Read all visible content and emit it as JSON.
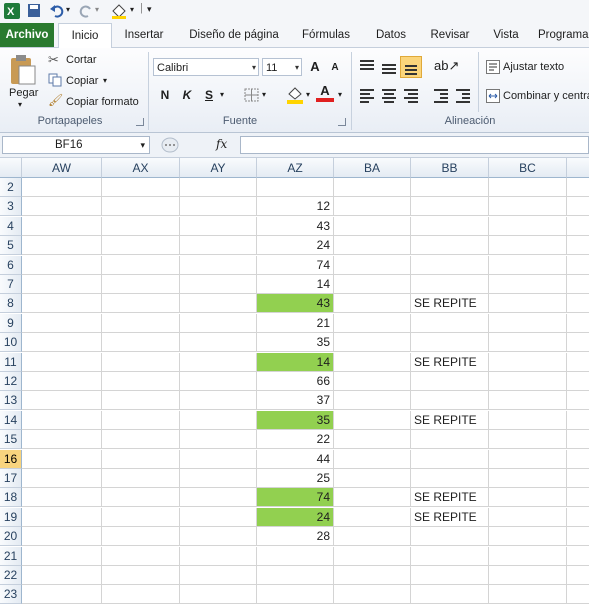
{
  "qat": {
    "icons": [
      "excel-logo-icon",
      "save-icon",
      "undo-icon",
      "redo-icon",
      "fill-color-icon",
      "customize-icon"
    ]
  },
  "tabs": [
    "Archivo",
    "Inicio",
    "Insertar",
    "Diseño de página",
    "Fórmulas",
    "Datos",
    "Revisar",
    "Vista",
    "Programa"
  ],
  "ribbon": {
    "clipboard": {
      "paste": "Pegar",
      "cut": "Cortar",
      "copy": "Copiar",
      "format_painter": "Copiar formato",
      "group": "Portapapeles"
    },
    "font": {
      "name": "Calibri",
      "size": "11",
      "bold": "N",
      "italic": "K",
      "underline": "S",
      "grow": "A",
      "shrink": "A",
      "group": "Fuente"
    },
    "alignment": {
      "wrap": "Ajustar texto",
      "merge": "Combinar y centrar",
      "group": "Alineación"
    }
  },
  "formula_bar": {
    "namebox": "BF16",
    "fx": "fx",
    "value": ""
  },
  "columns": [
    "AW",
    "AX",
    "AY",
    "AZ",
    "BA",
    "BB",
    "BC"
  ],
  "active_row": 16,
  "rows": [
    {
      "n": "2",
      "az": "",
      "bb": "",
      "green": false
    },
    {
      "n": "3",
      "az": "12",
      "bb": "",
      "green": false
    },
    {
      "n": "4",
      "az": "43",
      "bb": "",
      "green": false
    },
    {
      "n": "5",
      "az": "24",
      "bb": "",
      "green": false
    },
    {
      "n": "6",
      "az": "74",
      "bb": "",
      "green": false
    },
    {
      "n": "7",
      "az": "14",
      "bb": "",
      "green": false
    },
    {
      "n": "8",
      "az": "43",
      "bb": "SE REPITE",
      "green": true
    },
    {
      "n": "9",
      "az": "21",
      "bb": "",
      "green": false
    },
    {
      "n": "10",
      "az": "35",
      "bb": "",
      "green": false
    },
    {
      "n": "11",
      "az": "14",
      "bb": "SE REPITE",
      "green": true
    },
    {
      "n": "12",
      "az": "66",
      "bb": "",
      "green": false
    },
    {
      "n": "13",
      "az": "37",
      "bb": "",
      "green": false
    },
    {
      "n": "14",
      "az": "35",
      "bb": "SE REPITE",
      "green": true
    },
    {
      "n": "15",
      "az": "22",
      "bb": "",
      "green": false
    },
    {
      "n": "16",
      "az": "44",
      "bb": "",
      "green": false
    },
    {
      "n": "17",
      "az": "25",
      "bb": "",
      "green": false
    },
    {
      "n": "18",
      "az": "74",
      "bb": "SE REPITE",
      "green": true
    },
    {
      "n": "19",
      "az": "24",
      "bb": "SE REPITE",
      "green": true
    },
    {
      "n": "20",
      "az": "28",
      "bb": "",
      "green": false
    },
    {
      "n": "21",
      "az": "",
      "bb": "",
      "green": false
    },
    {
      "n": "22",
      "az": "",
      "bb": "",
      "green": false
    },
    {
      "n": "23",
      "az": "",
      "bb": "",
      "green": false
    }
  ],
  "colors": {
    "highlight": "#92d050",
    "file_tab": "#2a7a2f",
    "active_row_header": "#f8d47e"
  }
}
